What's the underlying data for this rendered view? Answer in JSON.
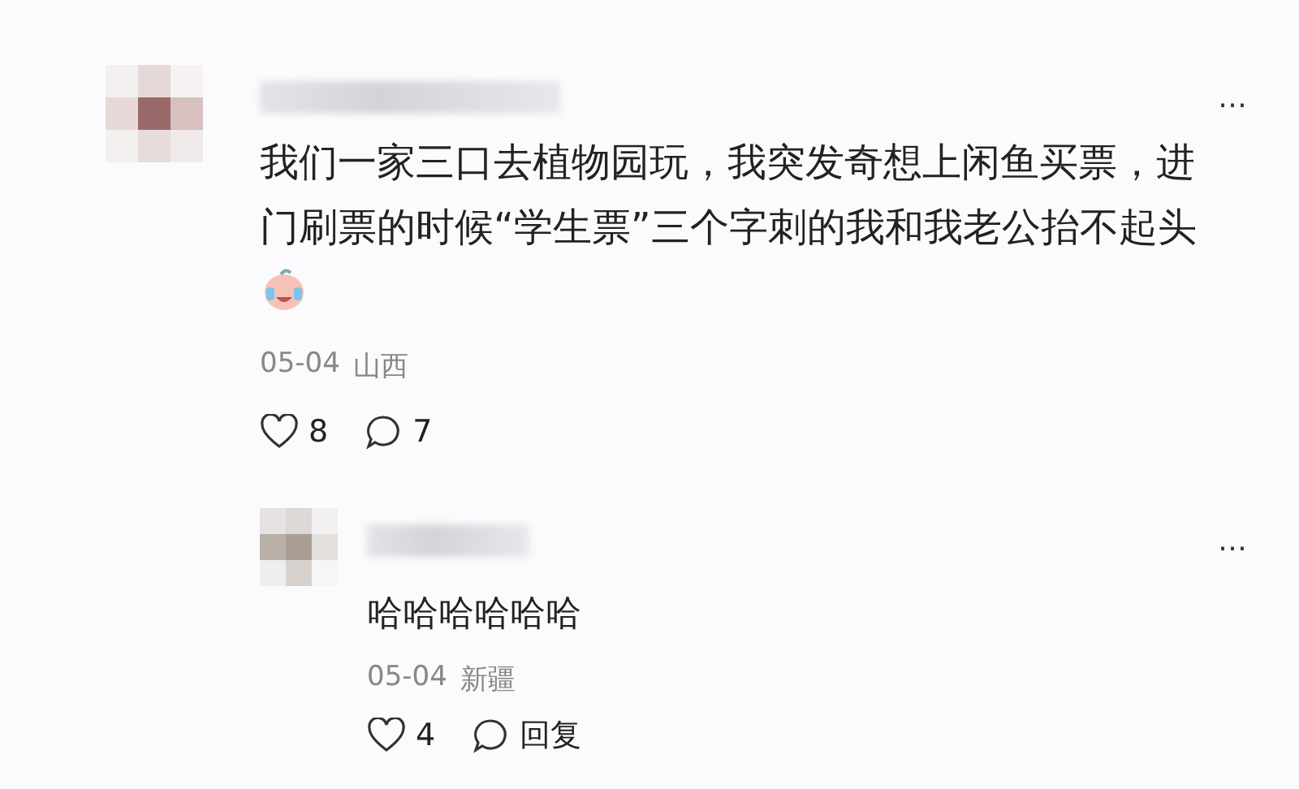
{
  "comment": {
    "text": "我们一家三口去植物园玩，我突发奇想上闲鱼买票，进门刷票的时候“学生票”三个字刺的我和我老公抬不起头",
    "date": "05-04",
    "location": "山西",
    "likes": "8",
    "comments": "7",
    "more": "…",
    "replies": [
      {
        "text": "哈哈哈哈哈哈",
        "date": "05-04",
        "location": "新疆",
        "likes": "4",
        "reply_label": "回复",
        "more": "…"
      }
    ]
  }
}
